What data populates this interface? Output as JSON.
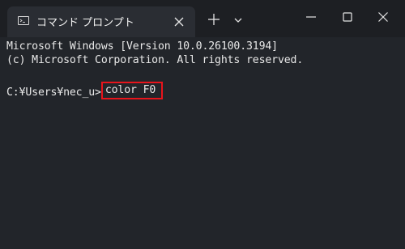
{
  "tab": {
    "title": "コマンド プロンプト",
    "icon": "command-prompt-icon"
  },
  "console": {
    "lines": [
      "Microsoft Windows [Version 10.0.26100.3194]",
      "(c) Microsoft Corporation. All rights reserved."
    ],
    "prompt": "C:¥Users¥nec_u>",
    "command": "color F0"
  },
  "colors": {
    "background": "#22252a",
    "titlebar": "#1d1f23",
    "text": "#e8e8e8",
    "highlight": "#e8141b"
  }
}
